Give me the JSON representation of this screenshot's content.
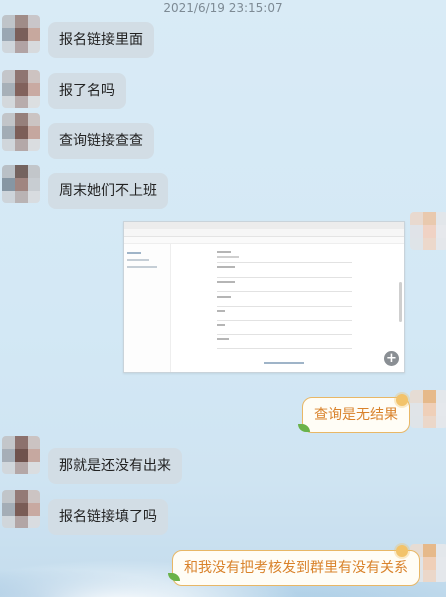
{
  "timestamp": "2021/6/19 23:15:07",
  "messages": [
    {
      "side": "left",
      "text": "报名链接里面"
    },
    {
      "side": "left",
      "text": "报了名吗"
    },
    {
      "side": "left",
      "text": "查询链接查查"
    },
    {
      "side": "left",
      "text": "周末她们不上班"
    },
    {
      "side": "right",
      "type": "image",
      "icon": "zoom-icon"
    },
    {
      "side": "right",
      "text": "查询是无结果"
    },
    {
      "side": "left",
      "text": "那就是还没有出来"
    },
    {
      "side": "left",
      "text": "报名链接填了吗"
    },
    {
      "side": "right",
      "text": "和我没有把考核发到群里有没有关系"
    }
  ],
  "colors": {
    "bubble_left": "#d2dde5",
    "bubble_right_text": "#d9822b",
    "bubble_right_border": "#e8b766"
  }
}
